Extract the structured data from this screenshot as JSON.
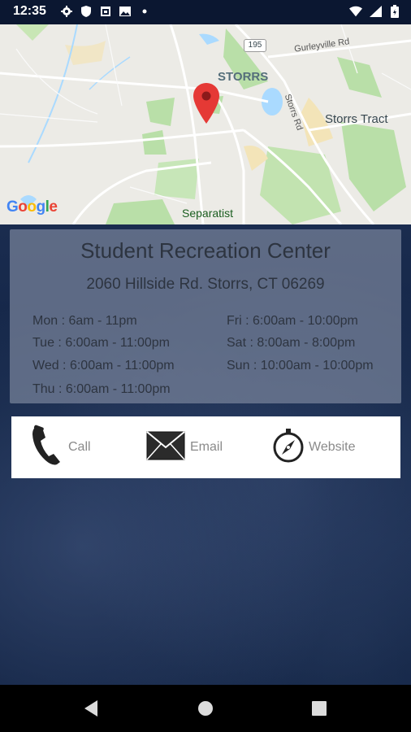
{
  "status_bar": {
    "time": "12:35",
    "left_icons": [
      "settings-icon",
      "shield-icon",
      "calendar-icon",
      "image-icon",
      "dot-icon"
    ],
    "right_icons": [
      "wifi-icon",
      "signal-icon",
      "battery-icon"
    ]
  },
  "map": {
    "labels": {
      "storrs": "STORRS",
      "storrs_tract": "Storrs Tract",
      "separatist": "Separatist",
      "gurleyville": "Gurleyville Rd",
      "storrs_rd": "Storrs Rd",
      "route": "195"
    },
    "attribution": "Google",
    "pin_icon": "map-pin-icon",
    "colors": {
      "pin": "#e53935",
      "park": "#b9dfa8",
      "water": "#aadaff"
    }
  },
  "facility": {
    "name": "Student Recreation Center",
    "address": "2060 Hillside Rd. Storrs, CT 06269",
    "hours": {
      "mon": "Mon : 6am - 11pm",
      "tue": "Tue : 6:00am - 11:00pm",
      "wed": "Wed : 6:00am - 11:00pm",
      "thu": "Thu : 6:00am - 11:00pm",
      "fri": "Fri : 6:00am - 10:00pm",
      "sat": "Sat : 8:00am - 8:00pm",
      "sun": "Sun : 10:00am - 10:00pm"
    }
  },
  "contact": {
    "call_label": "Call",
    "email_label": "Email",
    "website_label": "Website"
  },
  "nav": {
    "icons": [
      "back-icon",
      "home-icon",
      "recents-icon"
    ]
  }
}
